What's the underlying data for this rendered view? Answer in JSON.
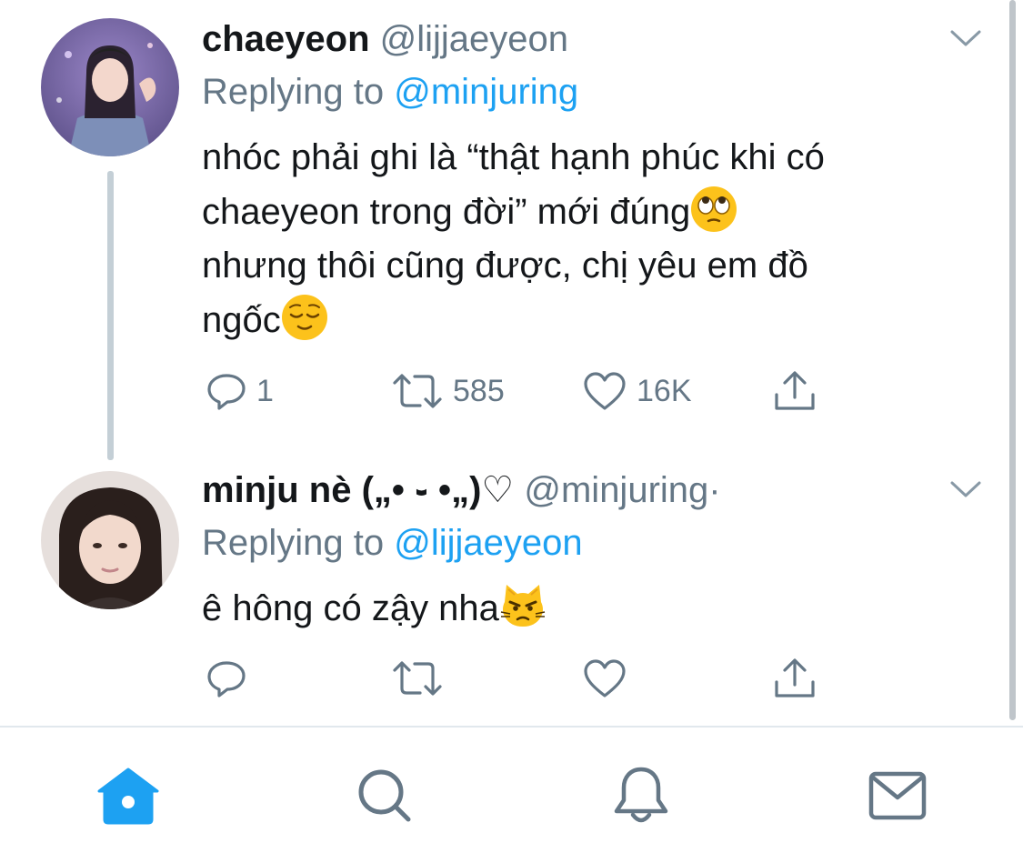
{
  "tweets": [
    {
      "author_name": "chaeyeon",
      "handle": "@lijjaeyeon",
      "replying_prefix": "Replying to",
      "replying_to": "@minjuring",
      "text_lines": [
        "nhóc phải ghi là “thật hạnh phúc khi có",
        "chaeyeon trong đời” mới đúng",
        "nhưng thôi cũng được, chị yêu em đồ",
        "ngốc"
      ],
      "emojis": [
        "face-with-rolling-eyes-emoji",
        "relieved-face-emoji"
      ],
      "counts": {
        "replies": "1",
        "retweets": "585",
        "likes": "16K"
      }
    },
    {
      "author_name": "minju nè („• ֊ •„)♡",
      "handle": "@minjuring",
      "handle_suffix": "·",
      "replying_prefix": "Replying to",
      "replying_to": "@lijjaeyeon",
      "text": "ê hông có zậy nha",
      "emojis": [
        "pouting-cat-emoji"
      ]
    }
  ],
  "icons": [
    "chevron-down-icon",
    "reply-icon",
    "retweet-icon",
    "like-icon",
    "share-icon",
    "home-icon",
    "search-icon",
    "notifications-icon",
    "messages-icon"
  ],
  "colors": {
    "accent": "#1da1f2",
    "secondary_text": "#657786",
    "primary_text": "#14171a"
  }
}
